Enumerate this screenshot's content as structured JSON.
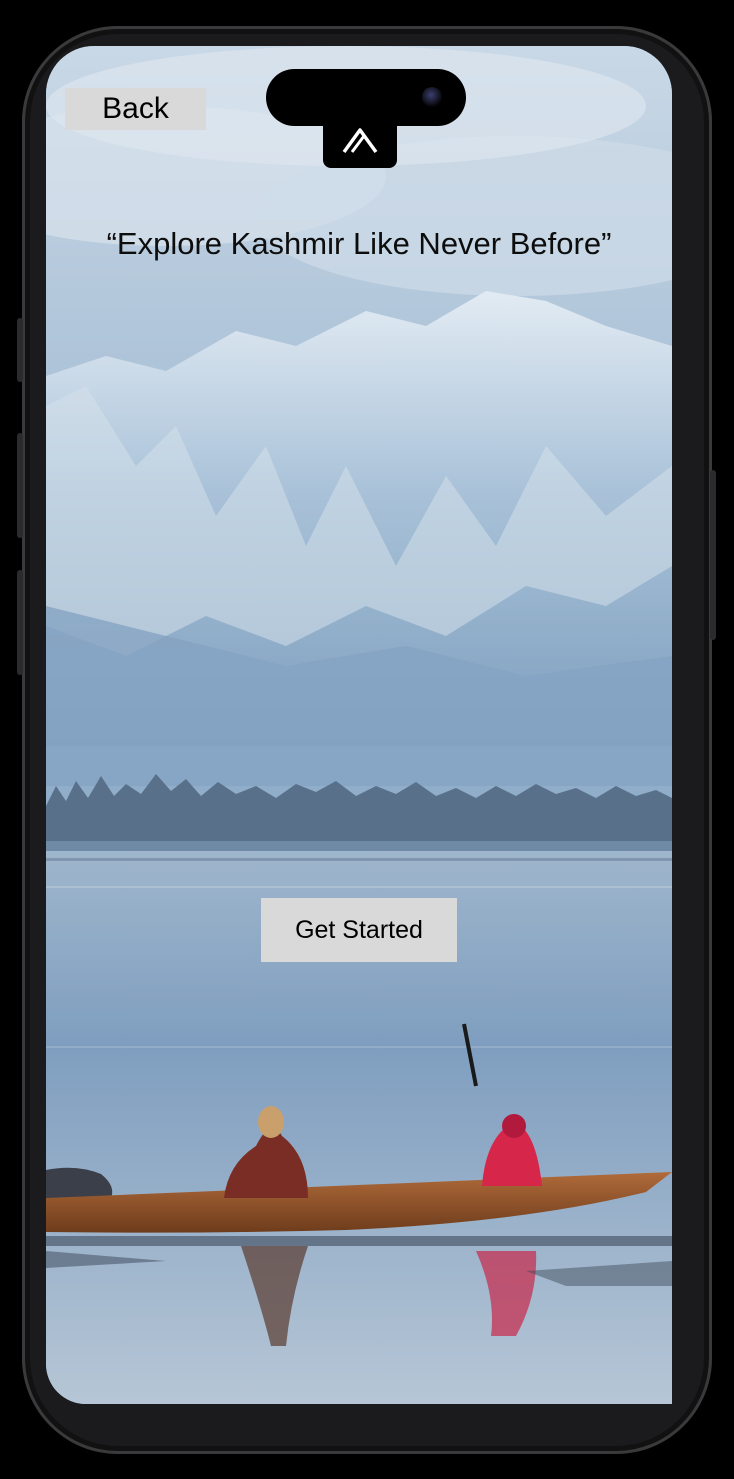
{
  "header": {
    "back_label": "Back",
    "logo_icon": "brand-logo-icon"
  },
  "hero": {
    "tagline": "“Explore Kashmir Like Never Before”",
    "background": "kashmir-lake-mountains-image"
  },
  "actions": {
    "get_started_label": "Get Started"
  },
  "colors": {
    "button_bg": "#d9d9d9",
    "text": "#000000",
    "frame": "#1b1b1d"
  }
}
